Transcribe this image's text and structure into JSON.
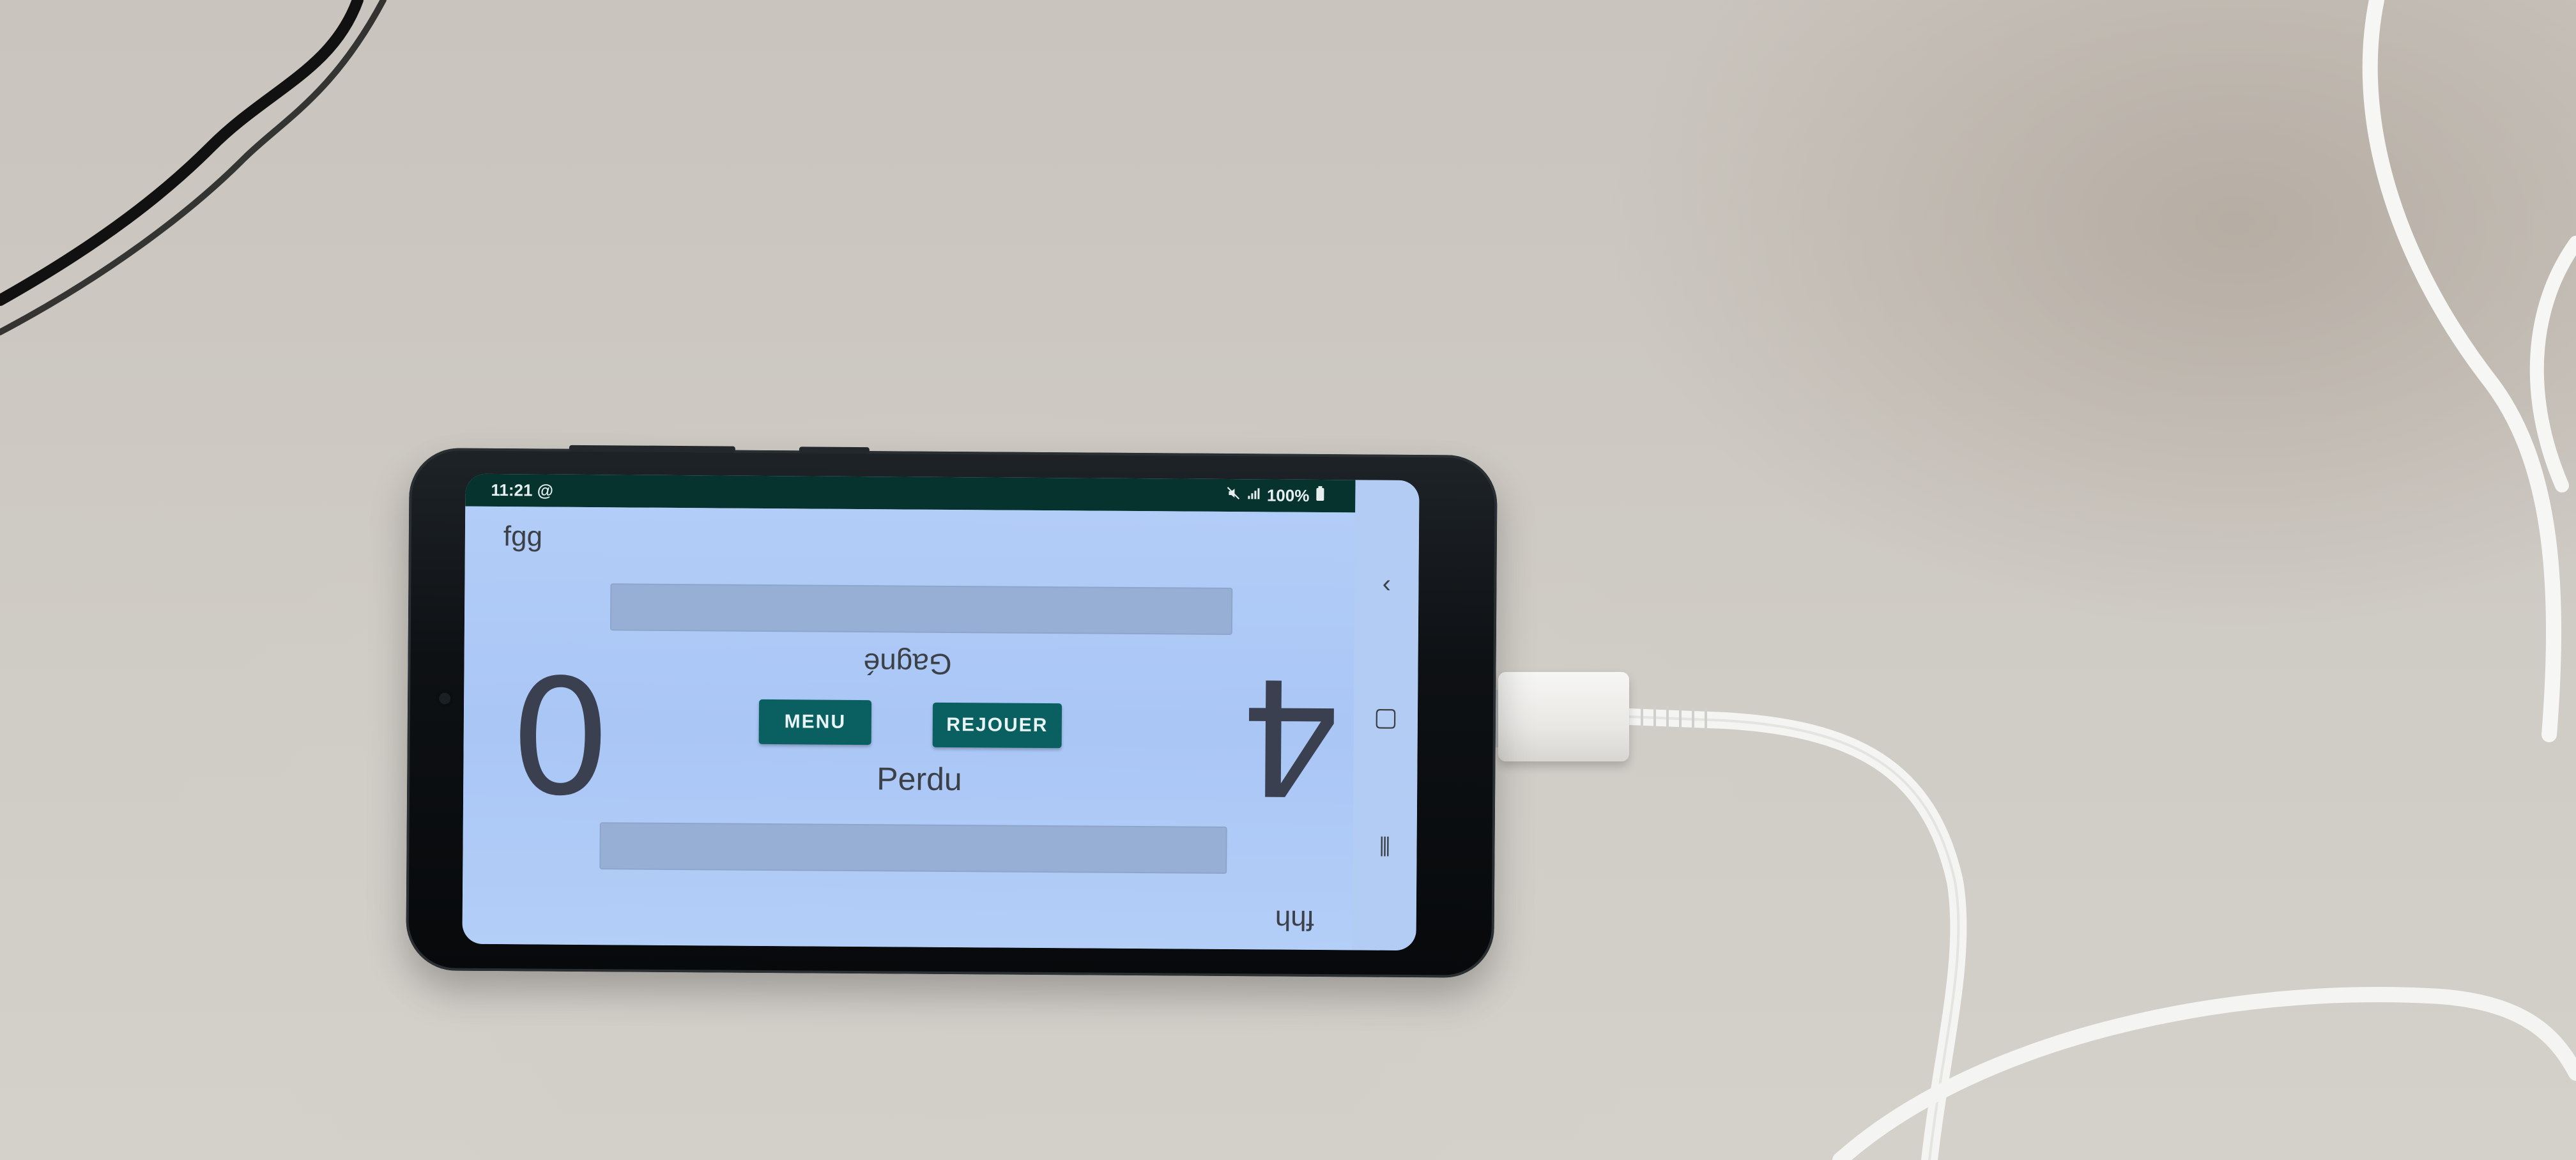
{
  "status_bar": {
    "time": "11:21",
    "extra_icon": "@",
    "mute_icon": "mute-icon",
    "signal_icon": "signal-icon",
    "battery": "100%",
    "battery_icon": "battery-icon"
  },
  "game": {
    "player_top_name": "fgg",
    "player_bottom_name": "fhh",
    "score_left": "0",
    "score_right": "4",
    "result_top": "Gagné",
    "result_bottom": "Perdu",
    "menu_label": "MENU",
    "replay_label": "REJOUER"
  },
  "nav": {
    "back": "‹",
    "home": "▢",
    "recent": "⦀"
  },
  "colors": {
    "status_bar": "#07332f",
    "app_background": "#aec9f5",
    "button": "#0a5f60",
    "text": "#3c4148"
  }
}
